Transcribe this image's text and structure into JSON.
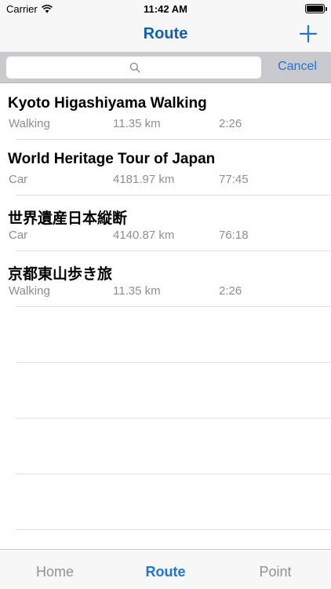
{
  "status_bar": {
    "carrier": "Carrier",
    "time": "11:42 AM",
    "icons": [
      "wifi-icon",
      "battery-icon"
    ]
  },
  "nav_bar": {
    "title": "Route",
    "add_icon": "plus-icon"
  },
  "search": {
    "value": "",
    "placeholder": "",
    "search_icon": "search-icon",
    "cancel_label": "Cancel"
  },
  "routes": [
    {
      "name": "Kyoto Higashiyama Walking",
      "mode": "Walking",
      "distance": "11.35 km",
      "duration": "2:26"
    },
    {
      "name": "World Heritage Tour of Japan",
      "mode": "Car",
      "distance": "4181.97 km",
      "duration": "77:45"
    },
    {
      "name": "世界遺産日本縦断",
      "mode": "Car",
      "distance": "4140.87 km",
      "duration": "76:18"
    },
    {
      "name": "京都東山歩き旅",
      "mode": "Walking",
      "distance": "11.35 km",
      "duration": "2:26"
    }
  ],
  "tab_bar": {
    "tabs": [
      {
        "label": "Home",
        "active": false
      },
      {
        "label": "Route",
        "active": true
      },
      {
        "label": "Point",
        "active": false
      }
    ]
  },
  "colors": {
    "accent": "#1f74d8",
    "title": "#0f5fb3",
    "secondary_text": "#8e8e93",
    "search_bar_bg": "#c9c9ce"
  }
}
